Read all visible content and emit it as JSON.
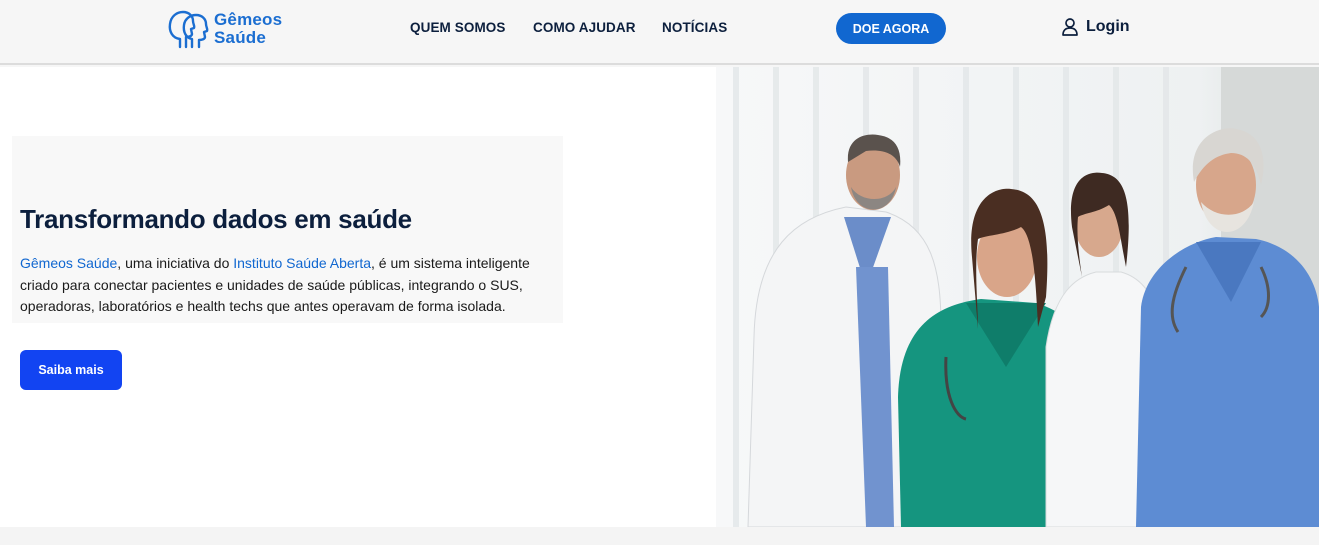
{
  "header": {
    "logo": {
      "line1": "Gêmeos",
      "line2": "Saúde"
    },
    "nav": [
      "QUEM SOMOS",
      "COMO AJUDAR",
      "NOTÍCIAS"
    ],
    "cta_label": "DOE AGORA",
    "login_label": "Login"
  },
  "hero": {
    "title": "Transformando dados em saúde",
    "text_link1": "Gêmeos Saúde",
    "text_part1": ", uma iniciativa do ",
    "text_link2": "Instituto Saúde Aberta",
    "text_part2": ", é um sistema inteligente criado para conectar pacientes e unidades de saúde públicas, integrando o SUS, operadoras, laboratórios e health techs que antes operavam de forma isolada.",
    "button_label": "Saiba mais"
  },
  "colors": {
    "brand_blue": "#1167d0",
    "button_blue": "#1244f2",
    "navy": "#0c1f3d"
  }
}
